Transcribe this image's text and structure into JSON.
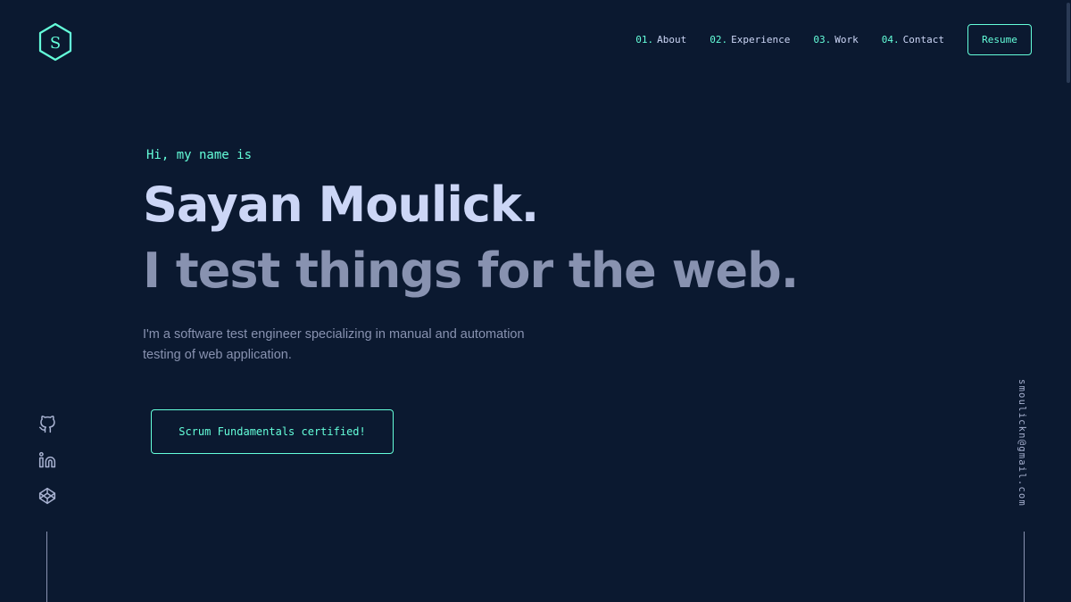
{
  "logo": {
    "letter": "S",
    "icon": "hexagon-logo-icon"
  },
  "nav": {
    "items": [
      {
        "num": "01.",
        "label": "About"
      },
      {
        "num": "02.",
        "label": "Experience"
      },
      {
        "num": "03.",
        "label": "Work"
      },
      {
        "num": "04.",
        "label": "Contact"
      }
    ],
    "resume_label": "Resume"
  },
  "hero": {
    "greeting": "Hi, my name is",
    "name": "Sayan Moulick.",
    "tagline": "I test things for the web.",
    "intro": "I'm a software test engineer specializing in manual and automation testing of web application.",
    "cta_label": "Scrum Fundamentals certified!"
  },
  "social": {
    "icons": [
      "github-icon",
      "linkedin-icon",
      "codepen-icon"
    ]
  },
  "email": "smoulickn@gmail.com",
  "colors": {
    "background": "#0b1930",
    "accent": "#64ffda",
    "heading": "#ccd6f6",
    "muted": "#8892b0"
  }
}
